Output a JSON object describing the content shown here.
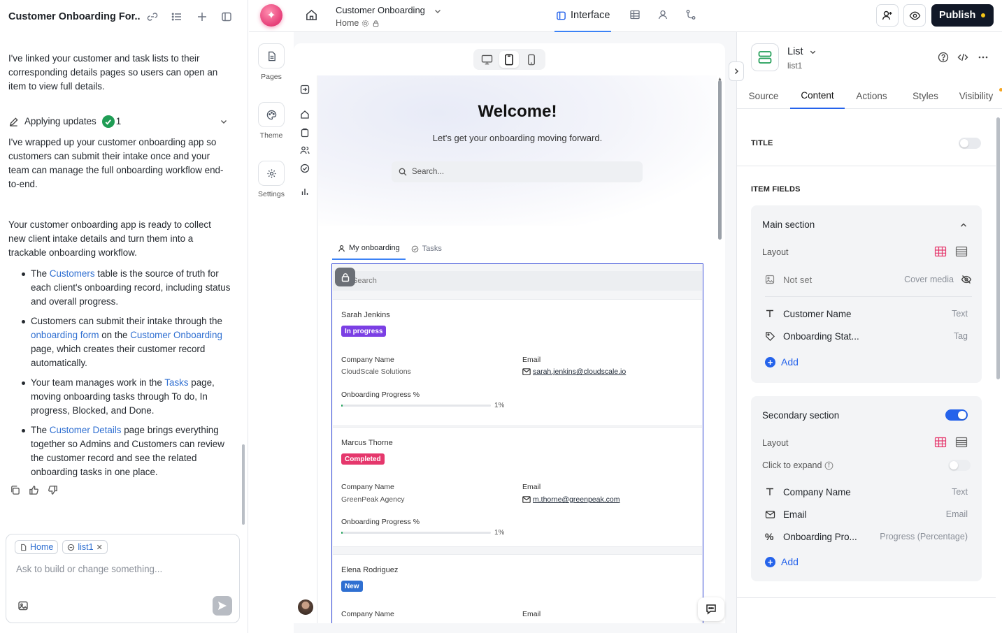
{
  "chat": {
    "title": "Customer Onboarding For...",
    "intro": "I've linked your customer and task lists to their corresponding details pages so users can open an item to view full details.",
    "applying_label": "Applying updates",
    "applying_count": "1",
    "para1": "I've wrapped up your customer onboarding app so customers can submit their intake once and your team can manage the full onboarding workflow end-to-end.",
    "para2": "Your customer onboarding app is ready to collect new client intake details and turn them into a trackable onboarding workflow.",
    "bullets": [
      {
        "a": "The ",
        "link1": "Customers",
        "b": " table is the source of truth for each client's onboarding record, including status and overall progress."
      },
      {
        "a": "Customers can submit their intake through the ",
        "link1": "onboarding form",
        "b": " on the ",
        "link2": "Customer Onboarding",
        "c": " page, which creates their customer record automatically."
      },
      {
        "a": "Your team manages work in the ",
        "link1": "Tasks",
        "b": " page, moving onboarding tasks through To do, In progress, Blocked, and Done."
      },
      {
        "a": "The ",
        "link1": "Customer Details",
        "b": " page brings everything together so Admins and Customers can review the customer record and see the related onboarding tasks in one place."
      }
    ],
    "composer": {
      "chip_home": "Home",
      "chip_list": "list1",
      "placeholder": "Ask to build or change something..."
    }
  },
  "topbar": {
    "app_name": "Customer Onboarding",
    "page_name": "Home",
    "interface_tab": "Interface",
    "publish_label": "Publish"
  },
  "rail": {
    "pages": "Pages",
    "theme": "Theme",
    "settings": "Settings"
  },
  "preview": {
    "welcome": "Welcome!",
    "subtitle": "Let's get your onboarding moving forward.",
    "search_placeholder": "Search...",
    "tabs": [
      "My onboarding",
      "Tasks"
    ],
    "list_search": "Search",
    "field_company": "Company Name",
    "field_email": "Email",
    "field_progress": "Onboarding Progress %",
    "cards": [
      {
        "name": "Sarah Jenkins",
        "status": "In progress",
        "status_color": "#7b3fe4",
        "company": "CloudScale Solutions",
        "email": "sarah.jenkins@cloudscale.io",
        "progress": 0.01,
        "progress_label": "1%"
      },
      {
        "name": "Marcus Thorne",
        "status": "Completed",
        "status_color": "#e5376c",
        "company": "GreenPeak Agency",
        "email": "m.thorne@greenpeak.com",
        "progress": 0.01,
        "progress_label": "1%"
      },
      {
        "name": "Elena Rodriguez",
        "status": "New",
        "status_color": "#2f6fd1",
        "company": "",
        "email": "",
        "progress": 0,
        "progress_label": ""
      }
    ]
  },
  "panel": {
    "component_type": "List",
    "component_id": "list1",
    "tabs": [
      "Source",
      "Content",
      "Actions",
      "Styles",
      "Visibility"
    ],
    "title_label": "TITLE",
    "item_fields_label": "ITEM FIELDS",
    "main_section": {
      "title": "Main section",
      "layout_label": "Layout",
      "media_value": "Not set",
      "media_label": "Cover media",
      "fields": [
        {
          "name": "Customer Name",
          "type": "Text"
        },
        {
          "name": "Onboarding Stat...",
          "type": "Tag"
        }
      ],
      "add_label": "Add"
    },
    "secondary_section": {
      "title": "Secondary section",
      "layout_label": "Layout",
      "expand_label": "Click to expand",
      "fields": [
        {
          "name": "Company Name",
          "type": "Text"
        },
        {
          "name": "Email",
          "type": "Email"
        },
        {
          "name": "Onboarding Pro...",
          "type": "Progress (Percentage)"
        }
      ],
      "add_label": "Add"
    }
  }
}
